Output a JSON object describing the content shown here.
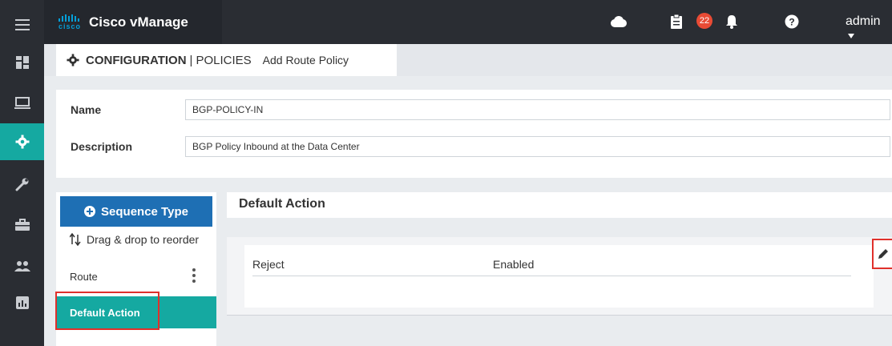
{
  "app": {
    "brand_logo_text": "cisco",
    "title": "Cisco vManage"
  },
  "topbar": {
    "notification_count": "22",
    "user": "admin"
  },
  "breadcrumb": {
    "section": "CONFIGURATION",
    "separator": "|",
    "subsection": "POLICIES",
    "page": "Add Route Policy"
  },
  "form": {
    "name_label": "Name",
    "name_value": "BGP-POLICY-IN",
    "description_label": "Description",
    "description_value": "BGP Policy Inbound at the Data Center"
  },
  "sequence": {
    "button_label": "Sequence Type",
    "drag_hint": "Drag & drop to reorder",
    "items": [
      {
        "label": "Route"
      },
      {
        "label": "Default Action"
      }
    ]
  },
  "default_action": {
    "title": "Default Action",
    "action": "Reject",
    "status": "Enabled"
  },
  "colors": {
    "rail_bg": "#2a2d33",
    "accent_teal": "#15a9a1",
    "primary_blue": "#1e6fb4",
    "badge_red": "#e94b35",
    "highlight_red": "#e0302b"
  },
  "icons": {
    "rail": [
      "menu-icon",
      "dashboard-icon",
      "monitor-icon",
      "configuration-gear-icon",
      "tools-wrench-icon",
      "maintenance-briefcase-icon",
      "administration-users-icon",
      "analytics-chart-icon"
    ],
    "topbar": [
      "cloud-icon",
      "tasks-clipboard-icon",
      "bell-icon",
      "help-icon",
      "chevron-down-icon"
    ]
  }
}
